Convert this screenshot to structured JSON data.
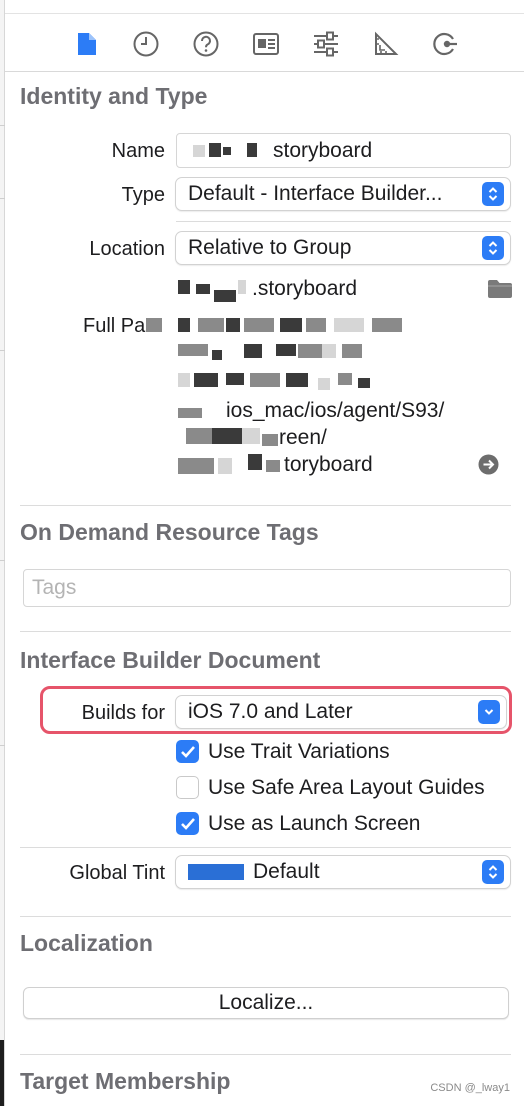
{
  "toolbar": {
    "icons": [
      "file-inspector-icon",
      "history-inspector-icon",
      "quick-help-icon",
      "identity-inspector-icon",
      "attributes-inspector-icon",
      "size-inspector-icon",
      "connections-inspector-icon"
    ],
    "active_icon": "file-inspector-icon",
    "accent": "#2c7cf6"
  },
  "identity_and_type": {
    "title": "Identity and Type",
    "name_label": "Name",
    "name_value": "storyboard",
    "type_label": "Type",
    "type_value": "Default - Interface Builder...",
    "location_label": "Location",
    "location_value": "Relative to Group",
    "location_file": ".storyboard",
    "full_path_label": "Full Pa",
    "full_path_line_4": "ios_mac/ios/agent/S93/",
    "full_path_line_5": "reen/",
    "full_path_line_6": "toryboard"
  },
  "on_demand": {
    "title": "On Demand Resource Tags",
    "tags_placeholder": "Tags"
  },
  "ib_document": {
    "title": "Interface Builder Document",
    "builds_for_label": "Builds for",
    "builds_for_value": "iOS 7.0 and Later",
    "use_trait_variations": "Use Trait Variations",
    "use_trait_variations_checked": true,
    "use_safe_area": "Use Safe Area Layout Guides",
    "use_safe_area_checked": false,
    "use_as_launch": "Use as Launch Screen",
    "use_as_launch_checked": true,
    "global_tint_label": "Global Tint",
    "global_tint_value": "Default",
    "global_tint_color": "#2a6fd6",
    "highlight_color": "#e6546a"
  },
  "localization": {
    "title": "Localization",
    "localize_button": "Localize..."
  },
  "target_membership": {
    "title": "Target Membership"
  },
  "watermark": "CSDN @_lway1"
}
